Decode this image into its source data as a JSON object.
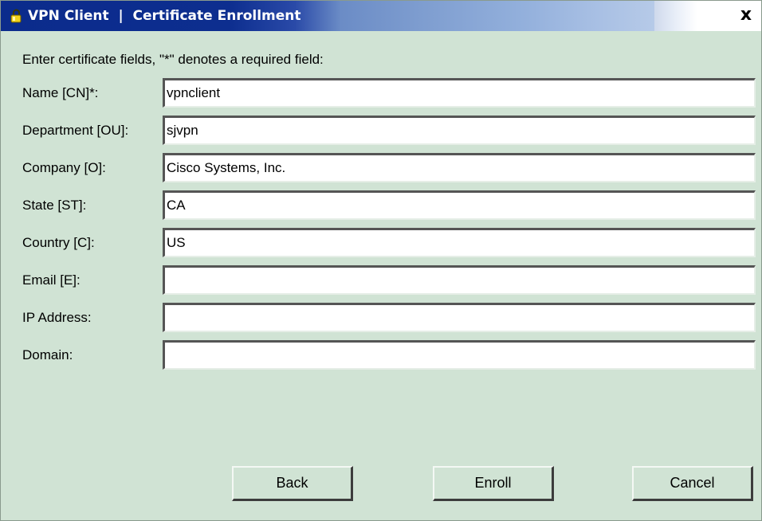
{
  "window": {
    "title": "VPN Client  |  Certificate Enrollment",
    "close_glyph": "x",
    "icon": "padlock-icon"
  },
  "instructions": "Enter certificate fields, \"*\" denotes a required field:",
  "fields": [
    {
      "label": "Name [CN]*:",
      "value": "vpnclient"
    },
    {
      "label": "Department [OU]:",
      "value": "sjvpn"
    },
    {
      "label": "Company [O]:",
      "value": "Cisco Systems, Inc."
    },
    {
      "label": "State [ST]:",
      "value": "CA"
    },
    {
      "label": "Country [C]:",
      "value": "US"
    },
    {
      "label": "Email [E]:",
      "value": ""
    },
    {
      "label": "IP Address:",
      "value": ""
    },
    {
      "label": "Domain:",
      "value": ""
    }
  ],
  "buttons": {
    "back": "Back",
    "enroll": "Enroll",
    "cancel": "Cancel"
  },
  "colors": {
    "background": "#d0e3d4",
    "title_gradient_start": "#0b2b8c",
    "title_gradient_end": "#b6cae8"
  }
}
